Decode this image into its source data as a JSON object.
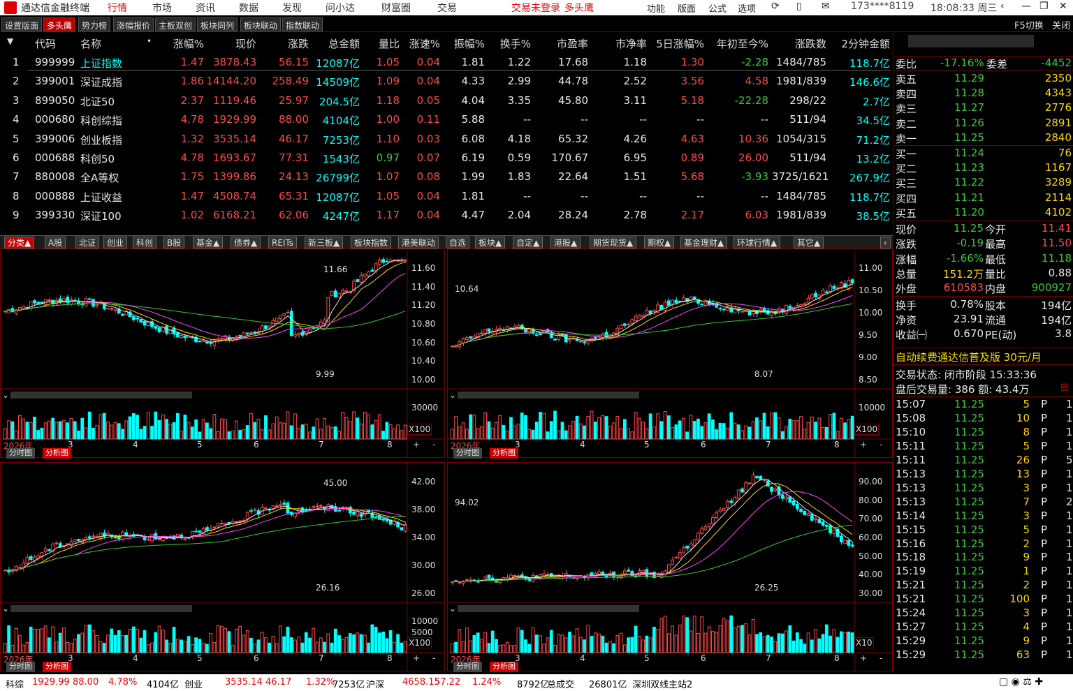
{
  "title_bar": {
    "app_name": "通达信金融终端",
    "menus": [
      "行情",
      "市场",
      "资讯",
      "数据",
      "发现",
      "问小达",
      "财富圈",
      "交易"
    ],
    "login_status": "交易未登录",
    "mode": "多头鹰",
    "right_menus": [
      "功能",
      "版面",
      "公式",
      "选项"
    ],
    "account": "173****8119",
    "time": "18:08:33 周三"
  },
  "top_tabs": [
    "设置版面",
    "多头鹰",
    "势力榜",
    "涨幅报价",
    "主板双创",
    "板块同列",
    "板块联动",
    "指数联动"
  ],
  "top_right": {
    "switch": "F5切换",
    "close": "关闭"
  },
  "table": {
    "headers": [
      "代码",
      "名称",
      "涨幅%",
      "现价",
      "涨跌",
      "总金额",
      "量比",
      "涨速%",
      "振幅%",
      "换手%",
      "市盈率",
      "市净率",
      "5日涨幅%",
      "年初至今%",
      "涨跌数",
      "2分钟金额"
    ],
    "rows": [
      {
        "n": "1",
        "code": "999999",
        "name": "上证指数",
        "chg": "1.47",
        "price": "3878.43",
        "delta": "56.15",
        "amt": "12087亿",
        "vr": "1.05",
        "spd": "0.04",
        "amp": "1.81",
        "turn": "1.22",
        "pe": "17.68",
        "pb": "1.18",
        "d5": "1.30",
        "ytd": "-2.28",
        "ud": "1484/785",
        "m2": "118.7亿"
      },
      {
        "n": "2",
        "code": "399001",
        "name": "深证成指",
        "chg": "1.86",
        "price": "14144.20",
        "delta": "258.49",
        "amt": "14509亿",
        "vr": "1.09",
        "spd": "0.04",
        "amp": "4.33",
        "turn": "2.99",
        "pe": "44.78",
        "pb": "2.52",
        "d5": "3.56",
        "ytd": "4.58",
        "ud": "1981/839",
        "m2": "146.6亿"
      },
      {
        "n": "3",
        "code": "899050",
        "name": "北证50",
        "chg": "2.37",
        "price": "1119.46",
        "delta": "25.97",
        "amt": "204.5亿",
        "vr": "1.18",
        "spd": "0.05",
        "amp": "4.04",
        "turn": "3.35",
        "pe": "45.80",
        "pb": "3.11",
        "d5": "5.18",
        "ytd": "-22.28",
        "ud": "298/22",
        "m2": "2.7亿"
      },
      {
        "n": "4",
        "code": "000680",
        "name": "科创综指",
        "chg": "4.78",
        "price": "1929.99",
        "delta": "88.00",
        "amt": "4104亿",
        "vr": "1.00",
        "spd": "0.11",
        "amp": "5.88",
        "turn": "--",
        "pe": "--",
        "pb": "--",
        "d5": "--",
        "ytd": "--",
        "ud": "511/94",
        "m2": "34.5亿"
      },
      {
        "n": "5",
        "code": "399006",
        "name": "创业板指",
        "chg": "1.32",
        "price": "3535.14",
        "delta": "46.17",
        "amt": "7253亿",
        "vr": "1.10",
        "spd": "0.03",
        "amp": "6.08",
        "turn": "4.18",
        "pe": "65.32",
        "pb": "4.26",
        "d5": "4.63",
        "ytd": "10.36",
        "ud": "1054/315",
        "m2": "71.2亿"
      },
      {
        "n": "6",
        "code": "000688",
        "name": "科创50",
        "chg": "4.78",
        "price": "1693.67",
        "delta": "77.31",
        "amt": "1543亿",
        "vr": "0.97",
        "spd": "0.07",
        "amp": "6.19",
        "turn": "0.59",
        "pe": "170.67",
        "pb": "6.95",
        "d5": "0.89",
        "ytd": "26.00",
        "ud": "511/94",
        "m2": "13.2亿"
      },
      {
        "n": "7",
        "code": "880008",
        "name": "全A等权",
        "chg": "1.75",
        "price": "1399.86",
        "delta": "24.13",
        "amt": "26799亿",
        "vr": "1.07",
        "spd": "0.08",
        "amp": "1.99",
        "turn": "1.83",
        "pe": "22.64",
        "pb": "1.51",
        "d5": "5.68",
        "ytd": "-3.93",
        "ud": "3725/1621",
        "m2": "267.9亿"
      },
      {
        "n": "8",
        "code": "000888",
        "name": "上证收益",
        "chg": "1.47",
        "price": "4508.74",
        "delta": "65.31",
        "amt": "12087亿",
        "vr": "1.05",
        "spd": "0.04",
        "amp": "1.81",
        "turn": "--",
        "pe": "--",
        "pb": "--",
        "d5": "--",
        "ytd": "--",
        "ud": "1484/785",
        "m2": "118.7亿"
      },
      {
        "n": "9",
        "code": "399330",
        "name": "深证100",
        "chg": "1.02",
        "price": "6168.21",
        "delta": "62.06",
        "amt": "4247亿",
        "vr": "1.17",
        "spd": "0.04",
        "amp": "4.47",
        "turn": "2.04",
        "pe": "28.24",
        "pb": "2.78",
        "d5": "2.17",
        "ytd": "6.03",
        "ud": "1981/839",
        "m2": "38.5亿"
      }
    ]
  },
  "category_tabs": [
    "分类▲",
    "A股",
    "北证",
    "创业",
    "科创",
    "B股",
    "基金▲",
    "债券▲",
    "REITs",
    "新三板▲",
    "板块指数",
    "港美联动",
    "自选",
    "板块▲",
    "自定▲",
    "港股▲",
    "期货现货▲",
    "期权▲",
    "基金理财▲",
    "环球行情▲",
    "其它▲"
  ],
  "charts": [
    {
      "y_ticks": [
        "11.60",
        "11.40",
        "11.20",
        "10.80",
        "10.60",
        "10.40",
        "10.00"
      ],
      "hi": "11.66",
      "lo": "9.99",
      "vol_ticks": [
        "30000"
      ],
      "vol_unit": "X100",
      "months": [
        "2026年",
        "3",
        "4",
        "5",
        "6",
        "7",
        "8"
      ]
    },
    {
      "y_ticks": [
        "11.00",
        "10.50",
        "10.00",
        "9.50",
        "9.00",
        "8.50"
      ],
      "hi": "10.64",
      "lo": "8.07",
      "vol_ticks": [
        "10000"
      ],
      "vol_unit": "X100",
      "months": [
        "2026年",
        "3",
        "4",
        "5",
        "6",
        "7",
        "8"
      ]
    },
    {
      "y_ticks": [
        "42.00",
        "38.00",
        "34.00",
        "30.00",
        "26.00"
      ],
      "hi": "45.00",
      "lo": "26.16",
      "vol_ticks": [
        "10000",
        "5000"
      ],
      "vol_unit": "X100",
      "months": [
        "2026年",
        "3",
        "4",
        "5",
        "6",
        "7",
        "8"
      ]
    },
    {
      "y_ticks": [
        "90.00",
        "80.00",
        "70.00",
        "60.00",
        "50.00",
        "40.00",
        "30.00"
      ],
      "hi": "94.02",
      "lo": "26.25",
      "vol_ticks": [],
      "vol_unit": "X10",
      "months": [
        "2026年",
        "3",
        "4",
        "5",
        "6",
        "7",
        "8"
      ]
    }
  ],
  "chart_tabs": {
    "a": "分时图",
    "b": "分析图"
  },
  "chart_buttons": {
    "plus": "+",
    "minus": "-"
  },
  "sidebar": {
    "weibi_label": "委比",
    "weibi": "-17.16%",
    "weicha_label": "委差",
    "weicha": "-4452",
    "asks": [
      {
        "l": "卖五",
        "p": "11.29",
        "v": "2350"
      },
      {
        "l": "卖四",
        "p": "11.28",
        "v": "4343"
      },
      {
        "l": "卖三",
        "p": "11.27",
        "v": "2776"
      },
      {
        "l": "卖二",
        "p": "11.26",
        "v": "2891"
      },
      {
        "l": "卖一",
        "p": "11.25",
        "v": "2840"
      }
    ],
    "bids": [
      {
        "l": "买一",
        "p": "11.24",
        "v": "76"
      },
      {
        "l": "买二",
        "p": "11.23",
        "v": "1167"
      },
      {
        "l": "买三",
        "p": "11.22",
        "v": "3289"
      },
      {
        "l": "买四",
        "p": "11.21",
        "v": "2114"
      },
      {
        "l": "买五",
        "p": "11.20",
        "v": "4102"
      }
    ],
    "stats": [
      {
        "l1": "现价",
        "v1": "11.25",
        "l2": "今开",
        "v2": "11.41"
      },
      {
        "l1": "涨跌",
        "v1": "-0.19",
        "l2": "最高",
        "v2": "11.50"
      },
      {
        "l1": "涨幅",
        "v1": "-1.66%",
        "l2": "最低",
        "v2": "11.18"
      },
      {
        "l1": "总量",
        "v1": "151.2万",
        "l2": "量比",
        "v2": "0.88"
      },
      {
        "l1": "外盘",
        "v1": "610583",
        "l2": "内盘",
        "v2": "900927"
      },
      {
        "l1": "换手",
        "v1": "0.78%",
        "l2": "股本",
        "v2": "194亿"
      },
      {
        "l1": "净资",
        "v1": "23.91",
        "l2": "流通",
        "v2": "194亿"
      },
      {
        "l1": "收益㈠",
        "v1": "0.670",
        "l2": "PE(动)",
        "v2": "3.8"
      }
    ],
    "promo": "自动续费通达信普及版 30元/月",
    "trade_status": "交易状态: 闭市阶段 15:33:36",
    "after_hours": "盘后交易量: 386  额: 43.4万",
    "ticks": [
      {
        "t": "15:07",
        "p": "11.25",
        "v": "5",
        "f": "P",
        "n": "1"
      },
      {
        "t": "15:08",
        "p": "11.25",
        "v": "10",
        "f": "P",
        "n": "1"
      },
      {
        "t": "15:10",
        "p": "11.25",
        "v": "8",
        "f": "P",
        "n": "1"
      },
      {
        "t": "15:11",
        "p": "11.25",
        "v": "5",
        "f": "P",
        "n": "1"
      },
      {
        "t": "15:11",
        "p": "11.25",
        "v": "26",
        "f": "P",
        "n": "5"
      },
      {
        "t": "15:13",
        "p": "11.25",
        "v": "13",
        "f": "P",
        "n": "1"
      },
      {
        "t": "15:13",
        "p": "11.25",
        "v": "3",
        "f": "P",
        "n": "1"
      },
      {
        "t": "15:13",
        "p": "11.25",
        "v": "7",
        "f": "P",
        "n": "2"
      },
      {
        "t": "15:14",
        "p": "11.25",
        "v": "3",
        "f": "P",
        "n": "1"
      },
      {
        "t": "15:15",
        "p": "11.25",
        "v": "5",
        "f": "P",
        "n": "1"
      },
      {
        "t": "15:16",
        "p": "11.25",
        "v": "2",
        "f": "P",
        "n": "1"
      },
      {
        "t": "15:18",
        "p": "11.25",
        "v": "9",
        "f": "P",
        "n": "1"
      },
      {
        "t": "15:19",
        "p": "11.25",
        "v": "1",
        "f": "P",
        "n": "1"
      },
      {
        "t": "15:21",
        "p": "11.25",
        "v": "2",
        "f": "P",
        "n": "1"
      },
      {
        "t": "15:21",
        "p": "11.25",
        "v": "100",
        "f": "P",
        "n": "1"
      },
      {
        "t": "15:24",
        "p": "11.25",
        "v": "3",
        "f": "P",
        "n": "1"
      },
      {
        "t": "15:27",
        "p": "11.25",
        "v": "4",
        "f": "P",
        "n": "1"
      },
      {
        "t": "15:29",
        "p": "11.25",
        "v": "9",
        "f": "P",
        "n": "1"
      },
      {
        "t": "15:29",
        "p": "11.25",
        "v": "63",
        "f": "P",
        "n": "1"
      }
    ]
  },
  "statusbar": [
    {
      "t": "科综",
      "c": "#000"
    },
    {
      "t": "1929.99",
      "c": "#e00"
    },
    {
      "t": "88.00",
      "c": "#e00"
    },
    {
      "t": "4.78%",
      "c": "#e00"
    },
    {
      "t": "4104亿",
      "c": "#000"
    },
    {
      "t": "创业",
      "c": "#000"
    },
    {
      "t": "3535.14",
      "c": "#e00"
    },
    {
      "t": "46.17",
      "c": "#e00"
    },
    {
      "t": "1.32%",
      "c": "#e00"
    },
    {
      "t": "7253亿",
      "c": "#000"
    },
    {
      "t": "沪深",
      "c": "#000"
    },
    {
      "t": "4658.15",
      "c": "#e00"
    },
    {
      "t": "57.22",
      "c": "#e00"
    },
    {
      "t": "1.24%",
      "c": "#e00"
    },
    {
      "t": "8792亿",
      "c": "#000"
    },
    {
      "t": "总成交",
      "c": "#000"
    },
    {
      "t": "26801亿",
      "c": "#000"
    },
    {
      "t": "深圳双线主站2",
      "c": "#000"
    }
  ],
  "colors": {
    "up": "#ff4a4a",
    "down": "#33cc33",
    "border": "#7a0000",
    "accent": "#c00000"
  }
}
